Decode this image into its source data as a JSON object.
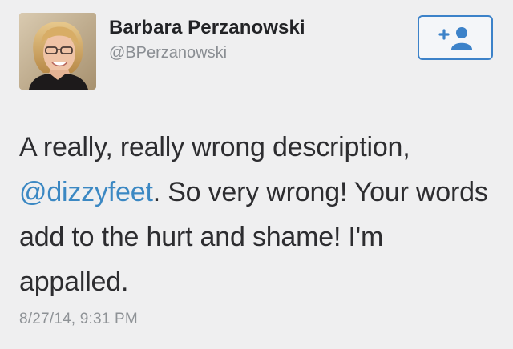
{
  "author": {
    "name": "Barbara Perzanowski",
    "handle": "@BPerzanowski",
    "avatar_icon": "person-portrait-photo"
  },
  "follow_button": {
    "icon": "add-user-icon",
    "color": "#3c82c9"
  },
  "tweet": {
    "text_before_mention": "A really, really wrong description,",
    "mention": "@dizzyfeet",
    "text_after_mention": ". So very wrong! Your words add to the hurt and shame! I'm appalled.",
    "timestamp": "8/27/14, 9:31 PM"
  },
  "colors": {
    "background": "#efeff0",
    "link": "#3b88c3",
    "text": "#2d2d30",
    "muted": "#8e9296"
  }
}
